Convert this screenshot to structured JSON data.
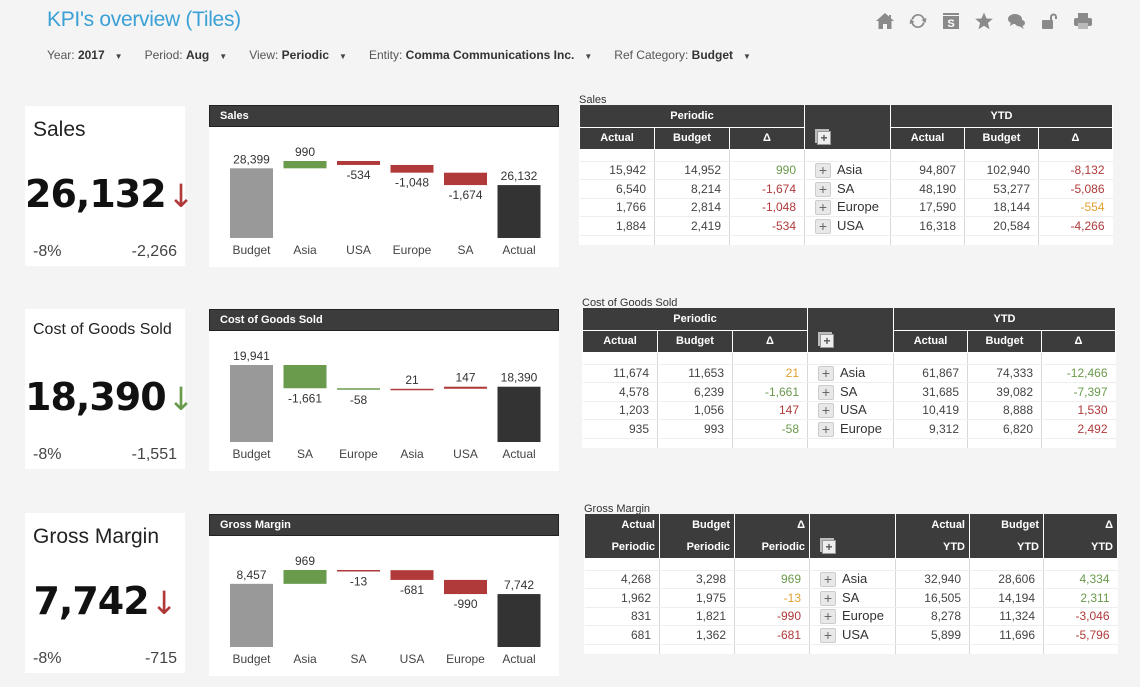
{
  "header": {
    "title": "KPI's overview (Tiles)",
    "toolbar": [
      "home-icon",
      "refresh-icon",
      "s-icon",
      "star-icon",
      "comments-icon",
      "unlock-icon",
      "print-icon"
    ]
  },
  "filters": [
    {
      "label": "Year:",
      "value": "2017"
    },
    {
      "label": "Period:",
      "value": "Aug"
    },
    {
      "label": "View:",
      "value": "Periodic"
    },
    {
      "label": "Entity:",
      "value": "Comma Communications Inc."
    },
    {
      "label": "Ref Category:",
      "value": "Budget"
    }
  ],
  "colors": {
    "positive": "#6a9a4c",
    "negative": "#b03a3a",
    "warning": "#e0a030",
    "budget_bar": "#999999",
    "actual_bar": "#333333",
    "title": "#3aa0d6"
  },
  "kpis": [
    {
      "name": "Sales",
      "value": "26,132",
      "arrow": "↓",
      "arrow_status": "negative",
      "pct": "-8%",
      "diff": "-2,266"
    },
    {
      "name": "Cost of Goods Sold",
      "value": "18,390",
      "arrow": "↓",
      "arrow_status": "positive",
      "pct": "-8%",
      "diff": "-1,551"
    },
    {
      "name": "Gross Margin",
      "value": "7,742",
      "arrow": "↓",
      "arrow_status": "negative",
      "pct": "-8%",
      "diff": "-715"
    }
  ],
  "chart_data": [
    {
      "type": "bar",
      "subtype": "waterfall",
      "title": "Sales",
      "categories": [
        "Budget",
        "Asia",
        "USA",
        "Europe",
        "SA",
        "Actual"
      ],
      "values": [
        28399,
        990,
        -534,
        -1048,
        -1674,
        26132
      ],
      "labels": [
        "28,399",
        "990",
        "-534",
        "-1,048",
        "-1,674",
        "26,132"
      ],
      "status": [
        "budget",
        "positive",
        "negative",
        "negative",
        "negative",
        "actual"
      ]
    },
    {
      "type": "bar",
      "subtype": "waterfall",
      "title": "Cost of Goods Sold",
      "categories": [
        "Budget",
        "SA",
        "Europe",
        "Asia",
        "USA",
        "Actual"
      ],
      "values": [
        19941,
        -1661,
        -58,
        21,
        147,
        18390
      ],
      "labels": [
        "19,941",
        "-1,661",
        "-58",
        "21",
        "147",
        "18,390"
      ],
      "status": [
        "budget",
        "positive",
        "positive",
        "negative",
        "negative",
        "actual"
      ]
    },
    {
      "type": "bar",
      "subtype": "waterfall",
      "title": "Gross Margin",
      "categories": [
        "Budget",
        "Asia",
        "SA",
        "USA",
        "Europe",
        "Actual"
      ],
      "values": [
        8457,
        969,
        -13,
        -681,
        -990,
        7742
      ],
      "labels": [
        "8,457",
        "969",
        "-13",
        "-681",
        "-990",
        "7,742"
      ],
      "status": [
        "budget",
        "positive",
        "negative",
        "negative",
        "negative",
        "actual"
      ]
    }
  ],
  "tables": [
    {
      "caption": "Sales",
      "group_periodic": "Periodic",
      "group_ytd": "YTD",
      "cols": [
        "Actual",
        "Budget",
        "Δ",
        "Actual",
        "Budget",
        "Δ"
      ],
      "rows": [
        {
          "p_act": "15,942",
          "p_bud": "14,952",
          "p_delta": "990",
          "p_status": "pos",
          "label": "Asia",
          "y_act": "94,807",
          "y_bud": "102,940",
          "y_delta": "-8,132",
          "y_status": "neg"
        },
        {
          "p_act": "6,540",
          "p_bud": "8,214",
          "p_delta": "-1,674",
          "p_status": "neg",
          "label": "SA",
          "y_act": "48,190",
          "y_bud": "53,277",
          "y_delta": "-5,086",
          "y_status": "neg"
        },
        {
          "p_act": "1,766",
          "p_bud": "2,814",
          "p_delta": "-1,048",
          "p_status": "neg",
          "label": "Europe",
          "y_act": "17,590",
          "y_bud": "18,144",
          "y_delta": "-554",
          "y_status": "warn"
        },
        {
          "p_act": "1,884",
          "p_bud": "2,419",
          "p_delta": "-534",
          "p_status": "neg",
          "label": "USA",
          "y_act": "16,318",
          "y_bud": "20,584",
          "y_delta": "-4,266",
          "y_status": "neg"
        }
      ]
    },
    {
      "caption": "Cost of Goods Sold",
      "group_periodic": "Periodic",
      "group_ytd": "YTD",
      "cols": [
        "Actual",
        "Budget",
        "Δ",
        "Actual",
        "Budget",
        "Δ"
      ],
      "rows": [
        {
          "p_act": "11,674",
          "p_bud": "11,653",
          "p_delta": "21",
          "p_status": "warn",
          "label": "Asia",
          "y_act": "61,867",
          "y_bud": "74,333",
          "y_delta": "-12,466",
          "y_status": "pos"
        },
        {
          "p_act": "4,578",
          "p_bud": "6,239",
          "p_delta": "-1,661",
          "p_status": "pos",
          "label": "SA",
          "y_act": "31,685",
          "y_bud": "39,082",
          "y_delta": "-7,397",
          "y_status": "pos"
        },
        {
          "p_act": "1,203",
          "p_bud": "1,056",
          "p_delta": "147",
          "p_status": "neg",
          "label": "USA",
          "y_act": "10,419",
          "y_bud": "8,888",
          "y_delta": "1,530",
          "y_status": "neg"
        },
        {
          "p_act": "935",
          "p_bud": "993",
          "p_delta": "-58",
          "p_status": "pos",
          "label": "Europe",
          "y_act": "9,312",
          "y_bud": "6,820",
          "y_delta": "2,492",
          "y_status": "neg"
        }
      ]
    },
    {
      "caption": "Gross Margin",
      "cols_top": [
        "Actual",
        "Budget",
        "Δ",
        "Actual",
        "Budget",
        "Δ"
      ],
      "cols_bottom": [
        "Periodic",
        "Periodic",
        "Periodic",
        "YTD",
        "YTD",
        "YTD"
      ],
      "rows": [
        {
          "p_act": "4,268",
          "p_bud": "3,298",
          "p_delta": "969",
          "p_status": "pos",
          "label": "Asia",
          "y_act": "32,940",
          "y_bud": "28,606",
          "y_delta": "4,334",
          "y_status": "pos"
        },
        {
          "p_act": "1,962",
          "p_bud": "1,975",
          "p_delta": "-13",
          "p_status": "warn",
          "label": "SA",
          "y_act": "16,505",
          "y_bud": "14,194",
          "y_delta": "2,311",
          "y_status": "pos"
        },
        {
          "p_act": "831",
          "p_bud": "1,821",
          "p_delta": "-990",
          "p_status": "neg",
          "label": "Europe",
          "y_act": "8,278",
          "y_bud": "11,324",
          "y_delta": "-3,046",
          "y_status": "neg"
        },
        {
          "p_act": "681",
          "p_bud": "1,362",
          "p_delta": "-681",
          "p_status": "neg",
          "label": "USA",
          "y_act": "5,899",
          "y_bud": "11,696",
          "y_delta": "-5,796",
          "y_status": "neg"
        }
      ]
    }
  ]
}
